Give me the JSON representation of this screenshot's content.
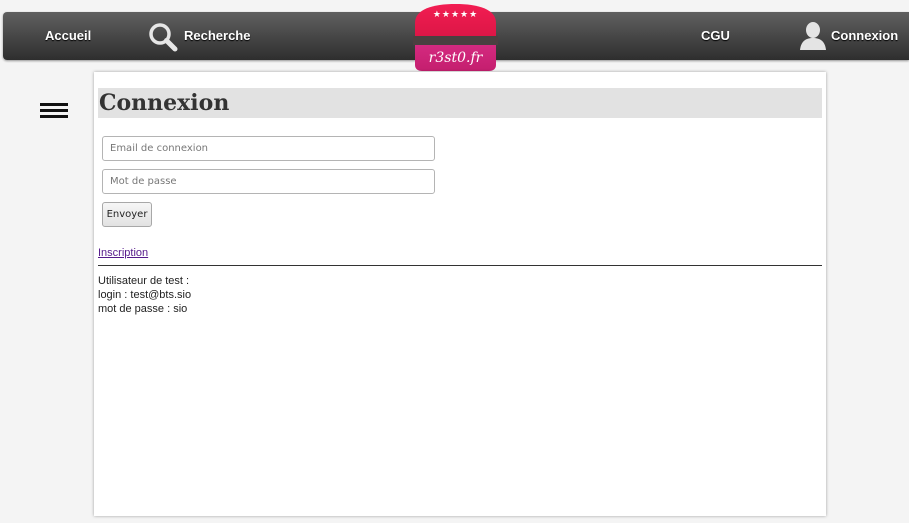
{
  "nav": {
    "home_label": "Accueil",
    "search_label": "Recherche",
    "terms_label": "CGU",
    "login_label": "Connexion",
    "search_icon": "magnifier-icon",
    "user_icon": "user-silhouette-icon"
  },
  "logo": {
    "text": "r3st0.fr",
    "stars": "★★★★★",
    "colors": {
      "top": "#e8174e",
      "bottom": "#d0247a",
      "band": "#4a4040"
    }
  },
  "menu": {
    "icon": "hamburger-icon"
  },
  "page": {
    "title": "Connexion"
  },
  "form": {
    "email_placeholder": "Email de connexion",
    "email_value": "",
    "password_placeholder": "Mot de passe",
    "password_value": "",
    "submit_label": "Envoyer"
  },
  "signup": {
    "link_label": "Inscription"
  },
  "test_user": {
    "heading": "Utilisateur de test :",
    "login_line": "login : test@bts.sio",
    "password_line": "mot de passe : sio"
  }
}
